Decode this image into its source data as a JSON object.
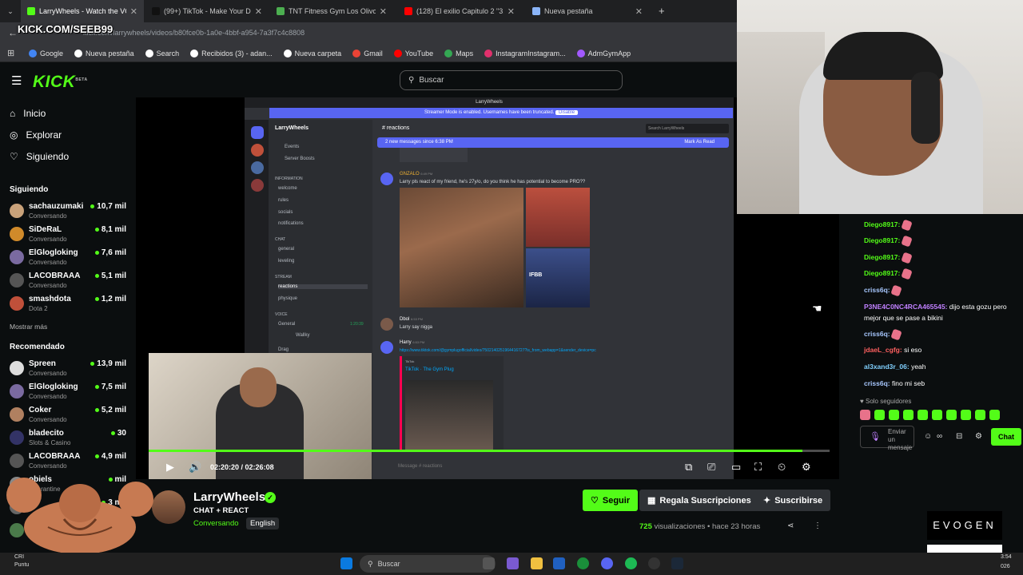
{
  "browser": {
    "tabs": [
      {
        "label": "LarryWheels - Watch the VOD o",
        "active": true,
        "color": "#53fc18"
      },
      {
        "label": "(99+) TikTok - Make Your Day",
        "active": false,
        "color": "#111111"
      },
      {
        "label": "TNT Fitness Gym Los Olivos - G",
        "active": false,
        "color": "#4caf50"
      },
      {
        "label": "(128) El exilio Capitulo 2 \"31 se",
        "active": false,
        "color": "#ff0000"
      },
      {
        "label": "Nueva pestaña",
        "active": false,
        "color": "#8ab4f8"
      }
    ],
    "new_tab": "+",
    "url": "kick.com/larrywheels/videos/b80fce0b-1a0e-4bbf-a954-7a3f7c4c8808",
    "overlay_brand": "KICK.COM/SEEB99",
    "bookmarks": [
      {
        "label": "Google",
        "color": "#4285f4"
      },
      {
        "label": "Nueva pestaña",
        "color": "#ffffff"
      },
      {
        "label": "Search",
        "color": "#ffffff"
      },
      {
        "label": "Recibidos (3) - adan...",
        "color": "#ffffff"
      },
      {
        "label": "Nueva carpeta",
        "color": "#ffffff"
      },
      {
        "label": "Gmail",
        "color": "#ea4335"
      },
      {
        "label": "YouTube",
        "color": "#ff0000"
      },
      {
        "label": "Maps",
        "color": "#34a853"
      },
      {
        "label": "InstagramInstagram...",
        "color": "#e1306c"
      },
      {
        "label": "AdmGymApp",
        "color": "#a259ff"
      }
    ]
  },
  "kick": {
    "logo": "KICK",
    "logo_beta": "BETA",
    "search_placeholder": "Buscar",
    "nav": [
      "Inicio",
      "Explorar",
      "Siguiendo"
    ],
    "following_title": "Siguiendo",
    "following": [
      {
        "name": "sachauzumaki",
        "cat": "Conversando",
        "viewers": "10,7 mil",
        "color": "#c9a27a"
      },
      {
        "name": "SiDeRaL",
        "cat": "Conversando",
        "viewers": "8,1 mil",
        "color": "#d08a2a"
      },
      {
        "name": "ElGlogloking",
        "cat": "Conversando",
        "viewers": "7,6 mil",
        "color": "#7a6aa0"
      },
      {
        "name": "LACOBRAAA",
        "cat": "Conversando",
        "viewers": "5,1 mil",
        "color": "#555555"
      },
      {
        "name": "smashdota",
        "cat": "Dota 2",
        "viewers": "1,2 mil",
        "color": "#c0503a"
      }
    ],
    "show_more": "Mostrar más",
    "recommended_title": "Recomendado",
    "recommended": [
      {
        "name": "Spreen",
        "cat": "Conversando",
        "viewers": "13,9 mil",
        "color": "#dddddd"
      },
      {
        "name": "ElGlogloking",
        "cat": "Conversando",
        "viewers": "7,5 mil",
        "color": "#7a6aa0"
      },
      {
        "name": "Coker",
        "cat": "Conversando",
        "viewers": "5,2 mil",
        "color": "#b08060"
      },
      {
        "name": "bladecito",
        "cat": "Slots & Casino",
        "viewers": "30",
        "color": "#333366"
      },
      {
        "name": "LACOBRAAA",
        "cat": "Conversando",
        "viewers": "4,9 mil",
        "color": "#555555"
      },
      {
        "name": "obiels",
        "cat": "Quarantine",
        "viewers": "mil",
        "color": "#888888"
      },
      {
        "name": "",
        "cat": "",
        "viewers": "3 mil",
        "color": "#666666"
      },
      {
        "name": "",
        "cat": "",
        "viewers": "mil",
        "color": "#4a7a4a"
      }
    ]
  },
  "discord": {
    "title": "LarryWheels",
    "banner": "Streamer Mode is enabled. Usernames have been truncated.",
    "banner_btn": "Disable",
    "server": "LarryWheels",
    "channel": "reactions",
    "new_messages": "2 new messages since 6:38 PM",
    "mark_read": "Mark As Read",
    "search": "Search LarryWheels",
    "sidebar_items": [
      "Events",
      "Server Boosts"
    ],
    "categories": [
      "INFORMATION",
      "CHAT",
      "STREAM",
      "VOICE"
    ],
    "channels_info": [
      "welcome",
      "rules",
      "socials",
      "notifications"
    ],
    "channels_chat": [
      "general",
      "leveling"
    ],
    "channels_stream": [
      "reactions",
      "physique"
    ],
    "channels_voice": [
      "General",
      "Wallky",
      "Drag"
    ],
    "voice_time": "1:20:39",
    "msg1_user": "GNZALO",
    "msg1_time": "6:49 PM",
    "msg1_text": "Larry pls react of my friend, he's 27y/o, do you think he has potential to become PRO??",
    "msg2_user": "Dbol",
    "msg2_time": "6:53 PM",
    "msg2_text": "Larry say nigga",
    "msg3_user": "Harry",
    "msg3_time": "6:53 PM",
    "msg3_link": "https://www.tiktok.com/@gymplugofficial/video/7502140251964416727?is_from_webapp=1&sender_device=pc",
    "embed_site": "TikTok",
    "embed_title": "TikTok · The Gym Plug",
    "ifbb": "IFBB",
    "input": "Message # reactions"
  },
  "player": {
    "current": "02:20:20",
    "duration": "02:26:08",
    "progress": 0.96
  },
  "chat": {
    "messages": [
      {
        "user": "Diego8917:",
        "text": "",
        "emote": true,
        "color": "#53fc18"
      },
      {
        "user": "Diego8917:",
        "text": "",
        "emote": true,
        "color": "#53fc18"
      },
      {
        "user": "Diego8917:",
        "text": "",
        "emote": true,
        "color": "#53fc18"
      },
      {
        "user": "Diego8917:",
        "text": "",
        "emote": true,
        "color": "#53fc18"
      },
      {
        "user": "criss6q:",
        "text": "",
        "emote": true,
        "color": "#a8c8ff"
      },
      {
        "user": "P3NE4C0NC4RCA465545:",
        "text": "dijo esta gozu pero mejor que se pase a bikini",
        "emote": false,
        "color": "#c080ff"
      },
      {
        "user": "criss6q:",
        "text": "",
        "emote": true,
        "color": "#a8c8ff"
      },
      {
        "user": "jdaeL_cgfg:",
        "text": "si eso",
        "emote": false,
        "color": "#ff6060"
      },
      {
        "user": "al3xand3r_06:",
        "text": "yeah",
        "emote": false,
        "color": "#80d0ff"
      },
      {
        "user": "criss6q:",
        "text": "fino mi seb",
        "emote": false,
        "color": "#a8c8ff"
      }
    ],
    "followers_only": "Solo seguidores",
    "input_placeholder": "Enviar un mensaje",
    "send": "Chat"
  },
  "channel": {
    "name": "LarryWheels",
    "title": "CHAT + REACT",
    "category": "Conversando",
    "language": "English",
    "follow": "Seguir",
    "gift": "Regala Suscripciones",
    "subscribe": "Suscribirse",
    "views_count": "725",
    "views_label": "visualizaciones",
    "posted": "hace 23 horas"
  },
  "overlay": {
    "evogen": "EVOGEN"
  },
  "taskbar": {
    "search": "Buscar",
    "weather_l1": "CRI",
    "weather_l2": "Puntu",
    "time": "3:54",
    "date": "026"
  }
}
